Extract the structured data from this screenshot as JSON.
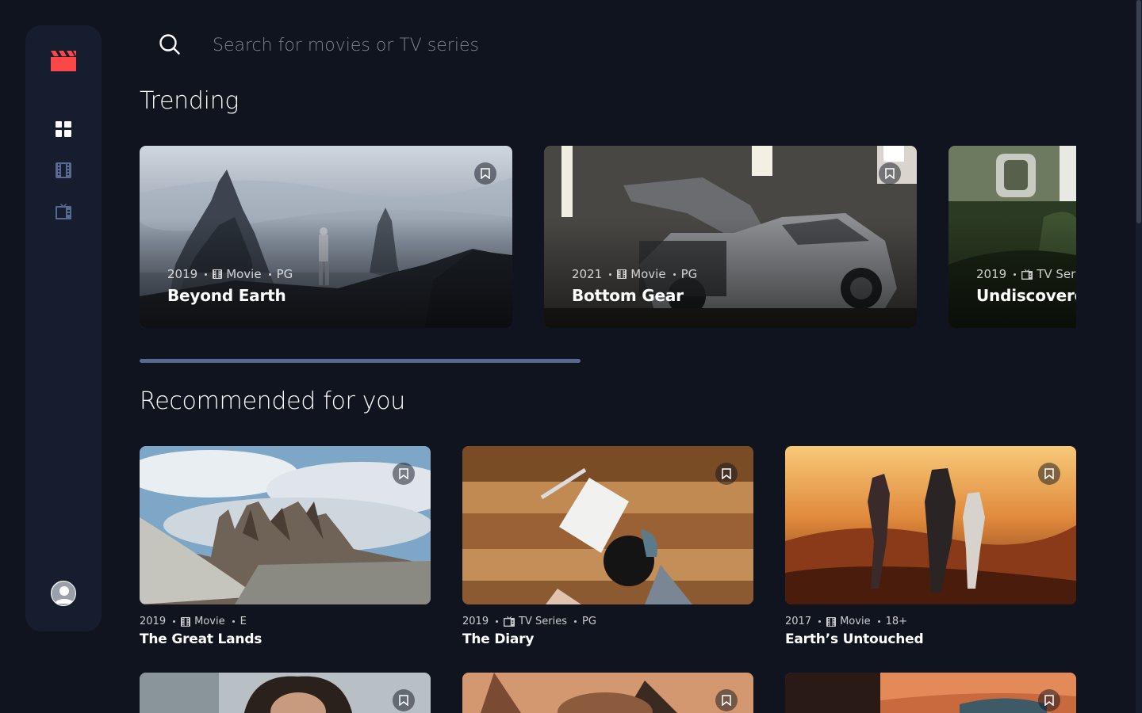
{
  "app": {
    "logo_icon": "movie-clapper-icon",
    "accent": "#fc4747"
  },
  "nav": [
    {
      "label": "Home",
      "icon": "grid-icon",
      "active": true
    },
    {
      "label": "Movies",
      "icon": "film-icon",
      "active": false
    },
    {
      "label": "TV Series",
      "icon": "tv-icon",
      "active": false
    }
  ],
  "search": {
    "placeholder": "Search for movies or TV series",
    "value": ""
  },
  "sections": {
    "trending": "Trending",
    "recommended": "Recommended for you"
  },
  "trending": [
    {
      "year": "2019",
      "category": "Movie",
      "category_icon": "film-icon",
      "rating": "PG",
      "title": "Beyond Earth"
    },
    {
      "year": "2021",
      "category": "Movie",
      "category_icon": "film-icon",
      "rating": "PG",
      "title": "Bottom Gear"
    },
    {
      "year": "2019",
      "category": "TV Series",
      "category_icon": "tv-icon",
      "rating": "",
      "title": "Undiscovered Cities"
    }
  ],
  "recommended": [
    {
      "year": "2019",
      "category": "Movie",
      "category_icon": "film-icon",
      "rating": "E",
      "title": "The Great Lands"
    },
    {
      "year": "2019",
      "category": "TV Series",
      "category_icon": "tv-icon",
      "rating": "PG",
      "title": "The Diary"
    },
    {
      "year": "2017",
      "category": "Movie",
      "category_icon": "film-icon",
      "rating": "18+",
      "title": "Earth’s Untouched"
    }
  ],
  "colors": {
    "background": "#10141e",
    "surface": "#161d2f",
    "muted": "#5a698f",
    "accent": "#fc4747"
  }
}
